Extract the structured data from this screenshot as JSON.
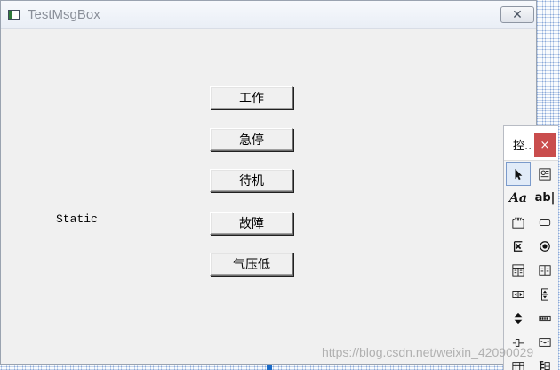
{
  "window": {
    "title": "TestMsgBox",
    "close_symbol": "✕"
  },
  "buttons": [
    {
      "label": "工作"
    },
    {
      "label": "急停"
    },
    {
      "label": "待机"
    },
    {
      "label": "故障"
    },
    {
      "label": "气压低"
    }
  ],
  "static_label": "Static",
  "toolbox": {
    "title": "控..",
    "close_symbol": "×",
    "tools": [
      {
        "icon": "pointer-icon"
      },
      {
        "icon": "picture-control-icon"
      },
      {
        "icon": "static-text-icon",
        "glyph": "Aa"
      },
      {
        "icon": "edit-control-icon",
        "glyph": "ab|"
      },
      {
        "icon": "group-box-icon"
      },
      {
        "icon": "button-icon"
      },
      {
        "icon": "check-box-icon"
      },
      {
        "icon": "radio-button-icon"
      },
      {
        "icon": "combo-box-icon"
      },
      {
        "icon": "list-box-icon"
      },
      {
        "icon": "horizontal-scrollbar-icon"
      },
      {
        "icon": "vertical-scrollbar-icon"
      },
      {
        "icon": "spin-control-icon"
      },
      {
        "icon": "progress-control-icon"
      },
      {
        "icon": "slider-control-icon"
      },
      {
        "icon": "hotkey-icon"
      },
      {
        "icon": "list-control-icon"
      },
      {
        "icon": "tree-control-icon"
      }
    ]
  },
  "watermark": "https://blog.csdn.net/weixin_42090029"
}
